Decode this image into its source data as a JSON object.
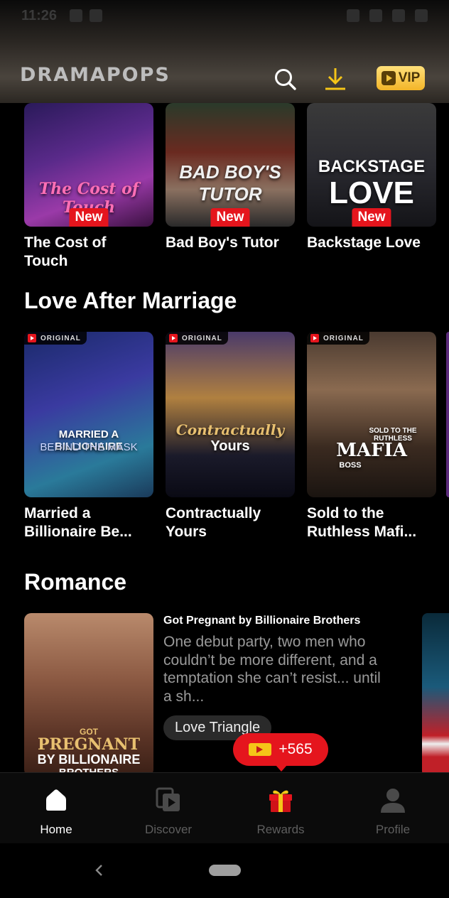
{
  "status_bar": {
    "time": "11:26"
  },
  "header": {
    "logo": "DRAMAPOPS",
    "vip_label": "VIP"
  },
  "top_row": [
    {
      "title": "The Cost of Touch",
      "poster_text": "The Cost of Touch",
      "badge": "New"
    },
    {
      "title": "Bad Boy's Tutor",
      "poster_text": "BAD BOY'S TUTOR",
      "badge": "New"
    },
    {
      "title": "Backstage Love",
      "poster_text_line1": "BACKSTAGE",
      "poster_text_line2": "LOVE",
      "badge": "New"
    }
  ],
  "sections": {
    "love_after_marriage": {
      "title": "Love After Marriage",
      "items": [
        {
          "title": "Married a Billionaire Be...",
          "poster_line1": "MARRIED A BILLIONAIRE",
          "poster_line2": "BEHIND THE MASK",
          "tag": "ORIGINAL"
        },
        {
          "title": "Contractually Yours",
          "poster_line1": "Contractually",
          "poster_line2": "Yours",
          "tag": "ORIGINAL"
        },
        {
          "title": "Sold to the Ruthless Mafi...",
          "poster_line1": "SOLD TO THE RUTHLESS",
          "poster_line2": "MAFIA",
          "poster_line3": "BOSS",
          "tag": "ORIGINAL"
        }
      ]
    },
    "romance": {
      "title": "Romance",
      "item": {
        "title": "Got Pregnant by Billionaire Brothers",
        "description": "One debut party, two men who couldn’t be more different, and a temptation she can’t resist... until a sh...",
        "tag": "Love Triangle",
        "poster_line1": "GOT",
        "poster_line2": "PREGNANT",
        "poster_line3": "BY BILLIONAIRE",
        "poster_line4": "BROTHERS"
      }
    }
  },
  "reward_pill": {
    "label": "+565"
  },
  "bottom_nav": [
    {
      "label": "Home",
      "icon": "home-icon",
      "active": true
    },
    {
      "label": "Discover",
      "icon": "discover-icon",
      "active": false
    },
    {
      "label": "Rewards",
      "icon": "gift-icon",
      "active": false
    },
    {
      "label": "Profile",
      "icon": "profile-icon",
      "active": false
    }
  ],
  "colors": {
    "accent_red": "#e5151d",
    "vip_gold": "#f3b528",
    "background": "#000000",
    "muted_text": "#9a9a9a"
  }
}
